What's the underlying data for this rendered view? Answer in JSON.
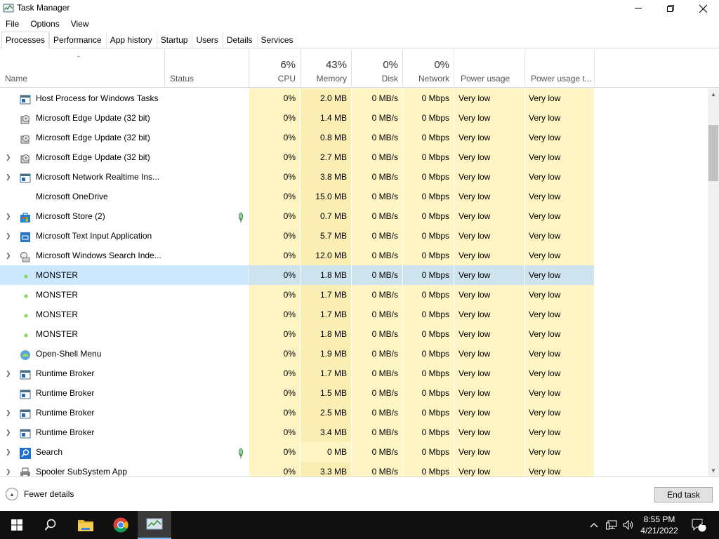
{
  "window": {
    "title": "Task Manager",
    "icons": {
      "app": "task-manager-icon",
      "minimize": "minimize-icon",
      "maximize": "restore-icon",
      "close": "close-icon"
    }
  },
  "menu": [
    "File",
    "Options",
    "View"
  ],
  "tabs": [
    "Processes",
    "Performance",
    "App history",
    "Startup",
    "Users",
    "Details",
    "Services"
  ],
  "active_tab": "Processes",
  "header": {
    "name_label": "Name",
    "status_label": "Status",
    "cpu": {
      "pct": "6%",
      "label": "CPU"
    },
    "memory": {
      "pct": "43%",
      "label": "Memory"
    },
    "disk": {
      "pct": "0%",
      "label": "Disk"
    },
    "network": {
      "pct": "0%",
      "label": "Network"
    },
    "power_label": "Power usage",
    "power_trend_label": "Power usage t..."
  },
  "processes": [
    {
      "name": "Host Process for Windows Tasks",
      "icon": "window-icon",
      "expandable": false,
      "leaf": false,
      "cpu": "0%",
      "mem": "2.0 MB",
      "disk": "0 MB/s",
      "net": "0 Mbps",
      "power": "Very low",
      "power_trend": "Very low"
    },
    {
      "name": "Microsoft Edge Update (32 bit)",
      "icon": "installer-icon",
      "expandable": false,
      "leaf": false,
      "cpu": "0%",
      "mem": "1.4 MB",
      "disk": "0 MB/s",
      "net": "0 Mbps",
      "power": "Very low",
      "power_trend": "Very low"
    },
    {
      "name": "Microsoft Edge Update (32 bit)",
      "icon": "installer-icon",
      "expandable": false,
      "leaf": false,
      "cpu": "0%",
      "mem": "0.8 MB",
      "disk": "0 MB/s",
      "net": "0 Mbps",
      "power": "Very low",
      "power_trend": "Very low"
    },
    {
      "name": "Microsoft Edge Update (32 bit)",
      "icon": "installer-icon",
      "expandable": true,
      "leaf": false,
      "cpu": "0%",
      "mem": "2.7 MB",
      "disk": "0 MB/s",
      "net": "0 Mbps",
      "power": "Very low",
      "power_trend": "Very low"
    },
    {
      "name": "Microsoft Network Realtime Ins...",
      "icon": "window-icon",
      "expandable": true,
      "leaf": false,
      "cpu": "0%",
      "mem": "3.8 MB",
      "disk": "0 MB/s",
      "net": "0 Mbps",
      "power": "Very low",
      "power_trend": "Very low"
    },
    {
      "name": "Microsoft OneDrive",
      "icon": "none",
      "expandable": false,
      "leaf": false,
      "cpu": "0%",
      "mem": "15.0 MB",
      "disk": "0 MB/s",
      "net": "0 Mbps",
      "power": "Very low",
      "power_trend": "Very low"
    },
    {
      "name": "Microsoft Store (2)",
      "icon": "store-icon",
      "expandable": true,
      "leaf": true,
      "cpu": "0%",
      "mem": "0.7 MB",
      "disk": "0 MB/s",
      "net": "0 Mbps",
      "power": "Very low",
      "power_trend": "Very low"
    },
    {
      "name": "Microsoft Text Input Application",
      "icon": "blue-app-icon",
      "expandable": true,
      "leaf": false,
      "cpu": "0%",
      "mem": "5.7 MB",
      "disk": "0 MB/s",
      "net": "0 Mbps",
      "power": "Very low",
      "power_trend": "Very low"
    },
    {
      "name": "Microsoft Windows Search Inde...",
      "icon": "search-indexer-icon",
      "expandable": true,
      "leaf": false,
      "cpu": "0%",
      "mem": "12.0 MB",
      "disk": "0 MB/s",
      "net": "0 Mbps",
      "power": "Very low",
      "power_trend": "Very low"
    },
    {
      "name": "MONSTER",
      "icon": "green-dot-icon",
      "expandable": false,
      "leaf": false,
      "selected": true,
      "cpu": "0%",
      "mem": "1.8 MB",
      "disk": "0 MB/s",
      "net": "0 Mbps",
      "power": "Very low",
      "power_trend": "Very low"
    },
    {
      "name": "MONSTER",
      "icon": "green-dot-icon",
      "expandable": false,
      "leaf": false,
      "cpu": "0%",
      "mem": "1.7 MB",
      "disk": "0 MB/s",
      "net": "0 Mbps",
      "power": "Very low",
      "power_trend": "Very low"
    },
    {
      "name": "MONSTER",
      "icon": "green-dot-icon",
      "expandable": false,
      "leaf": false,
      "cpu": "0%",
      "mem": "1.7 MB",
      "disk": "0 MB/s",
      "net": "0 Mbps",
      "power": "Very low",
      "power_trend": "Very low"
    },
    {
      "name": "MONSTER",
      "icon": "green-dot-icon",
      "expandable": false,
      "leaf": false,
      "cpu": "0%",
      "mem": "1.8 MB",
      "disk": "0 MB/s",
      "net": "0 Mbps",
      "power": "Very low",
      "power_trend": "Very low"
    },
    {
      "name": "Open-Shell Menu",
      "icon": "shell-icon",
      "expandable": false,
      "leaf": false,
      "cpu": "0%",
      "mem": "1.9 MB",
      "disk": "0 MB/s",
      "net": "0 Mbps",
      "power": "Very low",
      "power_trend": "Very low"
    },
    {
      "name": "Runtime Broker",
      "icon": "window-icon",
      "expandable": true,
      "leaf": false,
      "cpu": "0%",
      "mem": "1.7 MB",
      "disk": "0 MB/s",
      "net": "0 Mbps",
      "power": "Very low",
      "power_trend": "Very low"
    },
    {
      "name": "Runtime Broker",
      "icon": "window-icon",
      "expandable": false,
      "leaf": false,
      "cpu": "0%",
      "mem": "1.5 MB",
      "disk": "0 MB/s",
      "net": "0 Mbps",
      "power": "Very low",
      "power_trend": "Very low"
    },
    {
      "name": "Runtime Broker",
      "icon": "window-icon",
      "expandable": true,
      "leaf": false,
      "cpu": "0%",
      "mem": "2.5 MB",
      "disk": "0 MB/s",
      "net": "0 Mbps",
      "power": "Very low",
      "power_trend": "Very low"
    },
    {
      "name": "Runtime Broker",
      "icon": "window-icon",
      "expandable": true,
      "leaf": false,
      "cpu": "0%",
      "mem": "3.4 MB",
      "disk": "0 MB/s",
      "net": "0 Mbps",
      "power": "Very low",
      "power_trend": "Very low"
    },
    {
      "name": "Search",
      "icon": "search-app-icon",
      "expandable": true,
      "leaf": true,
      "cpu": "0%",
      "mem": "0 MB",
      "mem_light": true,
      "disk": "0 MB/s",
      "net": "0 Mbps",
      "power": "Very low",
      "power_trend": "Very low"
    },
    {
      "name": "Spooler SubSystem App",
      "icon": "printer-icon",
      "expandable": true,
      "leaf": false,
      "cpu": "0%",
      "mem": "3.3 MB",
      "disk": "0 MB/s",
      "net": "0 Mbps",
      "power": "Very low",
      "power_trend": "Very low"
    }
  ],
  "footer": {
    "fewer_details": "Fewer details",
    "end_task": "End task"
  },
  "taskbar": {
    "apps": [
      "windows-start-icon",
      "search-icon",
      "file-explorer-icon",
      "chrome-icon",
      "task-manager-icon"
    ],
    "tray": [
      "chevron-up-icon",
      "network-icon",
      "volume-icon"
    ],
    "time": "8:55 PM",
    "date": "4/21/2022",
    "notification_count": "1"
  },
  "colors": {
    "accent": "#cce8ff",
    "heat_light": "#fff4c4",
    "heat_mem": "#fbeeb5",
    "taskbar": "#101010"
  }
}
